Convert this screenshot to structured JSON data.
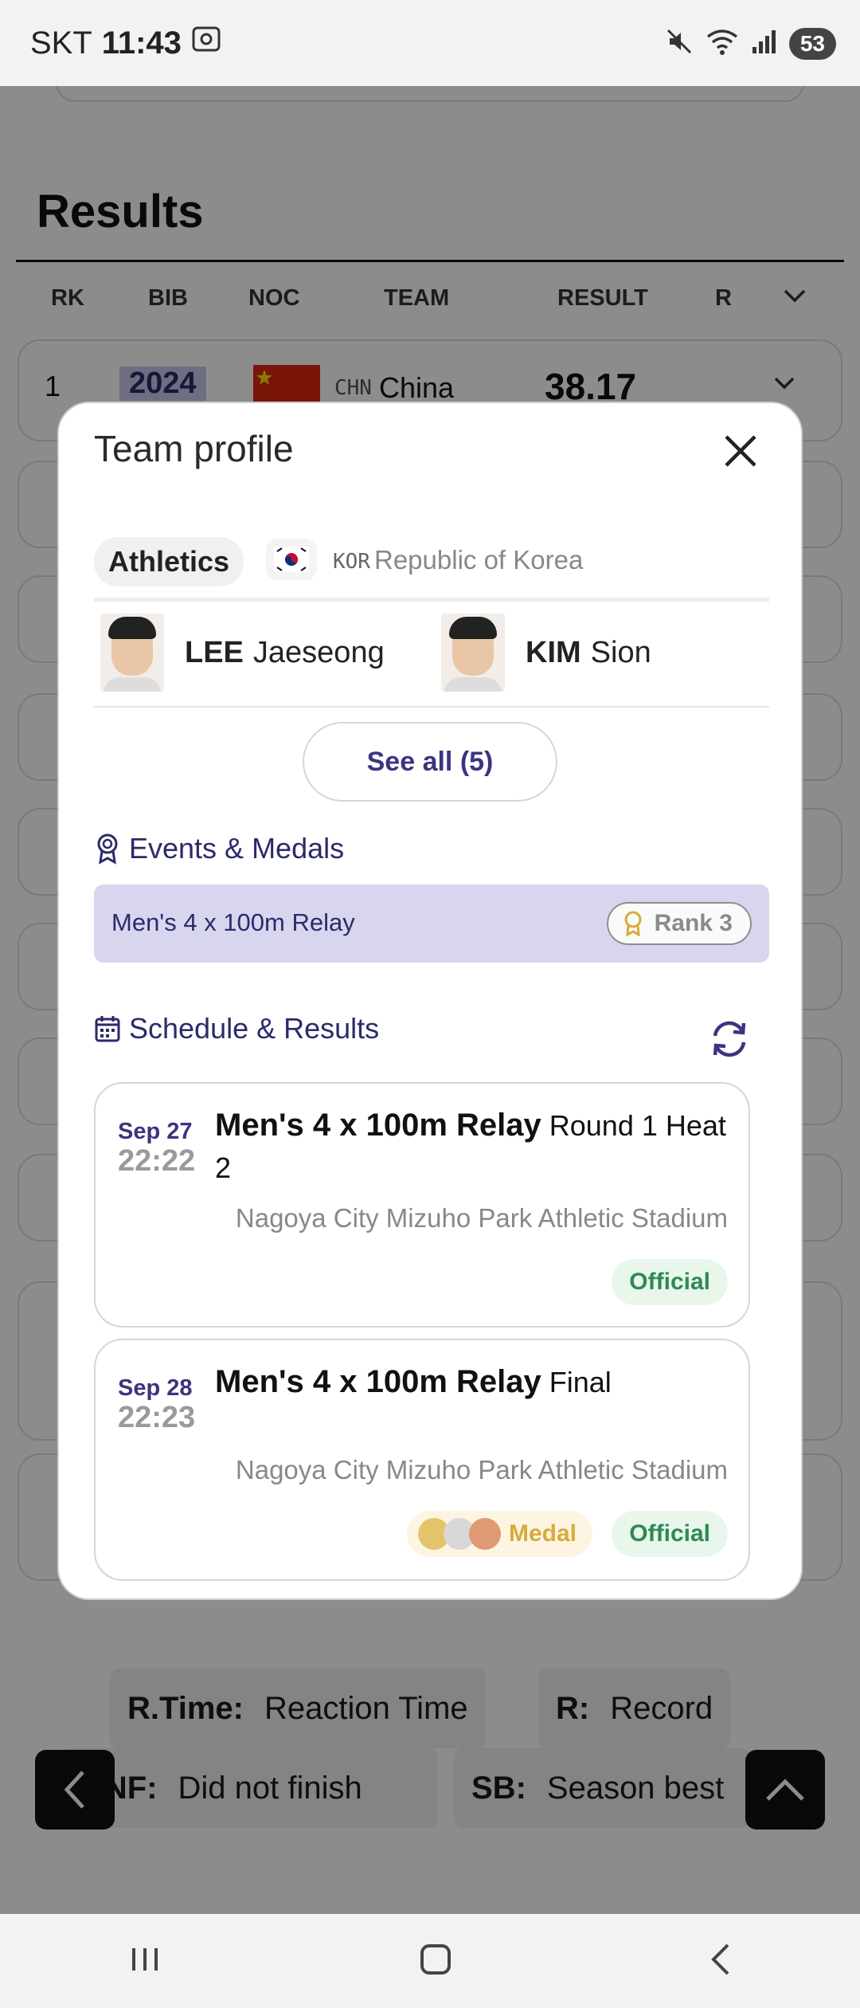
{
  "status_bar": {
    "carrier": "SKT",
    "time": "11:43",
    "battery": "53"
  },
  "background": {
    "results_title": "Results",
    "columns": [
      "RK",
      "BIB",
      "NOC",
      "TEAM",
      "RESULT",
      "R"
    ],
    "first_row": {
      "rank": "1",
      "bib": "2024",
      "noc": "CHN",
      "team": "China",
      "result": "38.17"
    },
    "legend": [
      {
        "key": "R.Time:",
        "value": "Reaction Time"
      },
      {
        "key": "R:",
        "value": "Record"
      },
      {
        "key": "DNF:",
        "value": "Did not finish"
      },
      {
        "key": "SB:",
        "value": "Season best"
      }
    ]
  },
  "modal": {
    "title": "Team profile",
    "sport": "Athletics",
    "noc_code": "KOR",
    "country": "Republic of Korea",
    "athletes": [
      {
        "surname": "LEE",
        "given": "Jaeseong"
      },
      {
        "surname": "KIM",
        "given": "Sion"
      }
    ],
    "see_all_label": "See all (5)",
    "events_heading": "Events & Medals",
    "event": {
      "name": "Men's 4 x 100m Relay",
      "rank_label": "Rank 3"
    },
    "schedule_heading": "Schedule & Results",
    "schedule": [
      {
        "date": "Sep 27",
        "time": "22:22",
        "event": "Men's 4 x 100m Relay",
        "round": "Round 1 Heat 2",
        "venue": "Nagoya City Mizuho Park Athletic Stadium",
        "status": "Official"
      },
      {
        "date": "Sep 28",
        "time": "22:23",
        "event": "Men's 4 x 100m Relay",
        "round": "Final",
        "venue": "Nagoya City Mizuho Park Athletic Stadium",
        "medal_label": "Medal",
        "status": "Official"
      }
    ]
  },
  "colors": {
    "accent": "#3b3580",
    "event_bar": "#d8d6ee",
    "official_text": "#2d8a53",
    "medal_text": "#d9aa3b",
    "gold": "#e3c46b",
    "silver": "#d8d8d8",
    "bronze": "#df9a73"
  }
}
